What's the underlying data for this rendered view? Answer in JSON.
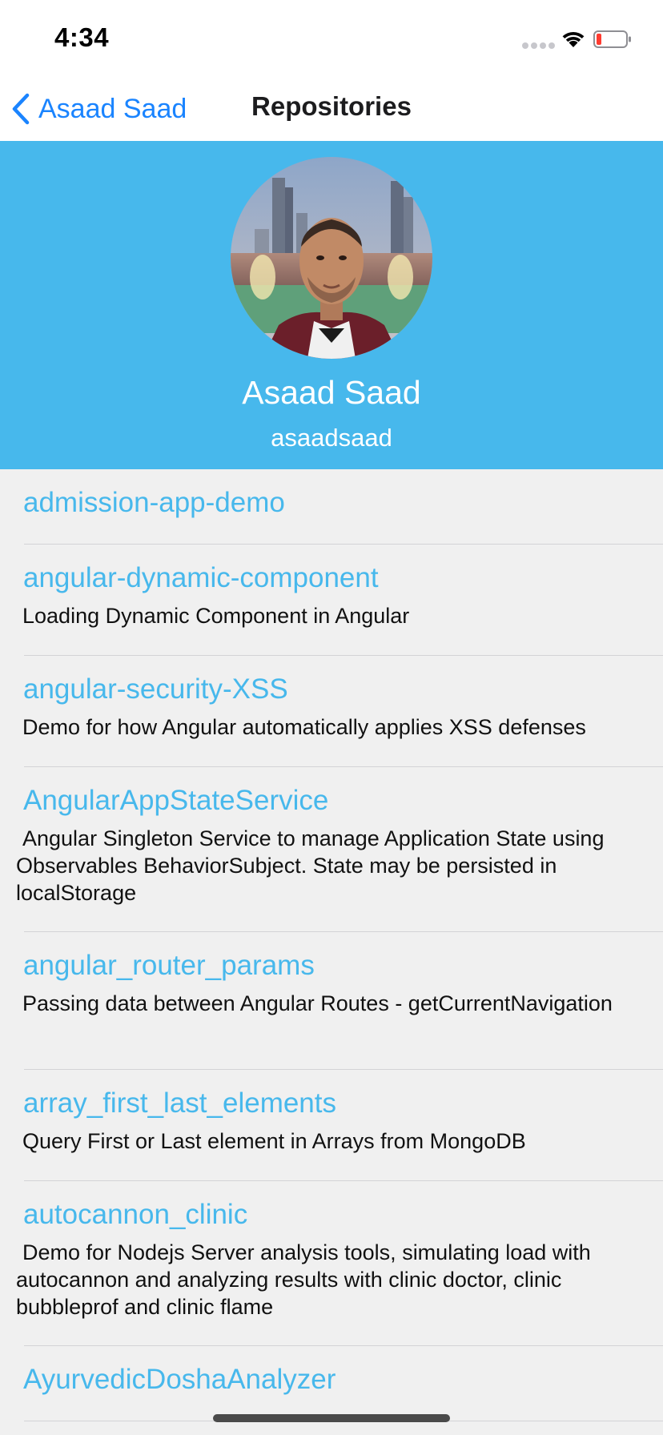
{
  "status_bar": {
    "time": "4:34",
    "signal_icon": "signal-dots-icon",
    "wifi_icon": "wifi-icon",
    "battery_icon": "battery-icon",
    "battery_level": 0.1,
    "battery_color": "#ff3b30"
  },
  "nav": {
    "back_label": "Asaad Saad",
    "back_icon": "chevron-left-icon",
    "title": "Repositories"
  },
  "profile": {
    "name": "Asaad Saad",
    "login": "asaadsaad",
    "avatar": "avatar-photo",
    "header_color": "#47b8ec"
  },
  "repos": [
    {
      "name": "admission-app-demo",
      "description": ""
    },
    {
      "name": "angular-dynamic-component",
      "description": "Loading Dynamic Component in Angular"
    },
    {
      "name": "angular-security-XSS",
      "description": "Demo for how Angular automatically applies XSS defenses"
    },
    {
      "name": "AngularAppStateService",
      "description": "Angular Singleton Service to manage Application State using Observables BehaviorSubject. State may be persisted in localStorage"
    },
    {
      "name": "angular_router_params",
      "description": "Passing data between Angular Routes - getCurrentNavigation"
    },
    {
      "name": "array_first_last_elements",
      "description": "Query First or Last element in Arrays from MongoDB"
    },
    {
      "name": "autocannon_clinic",
      "description": "Demo for Nodejs Server analysis tools, simulating load with autocannon and analyzing results with clinic doctor, clinic bubbleprof and clinic flame"
    },
    {
      "name": "AyurvedicDoshaAnalyzer",
      "description": ""
    }
  ]
}
